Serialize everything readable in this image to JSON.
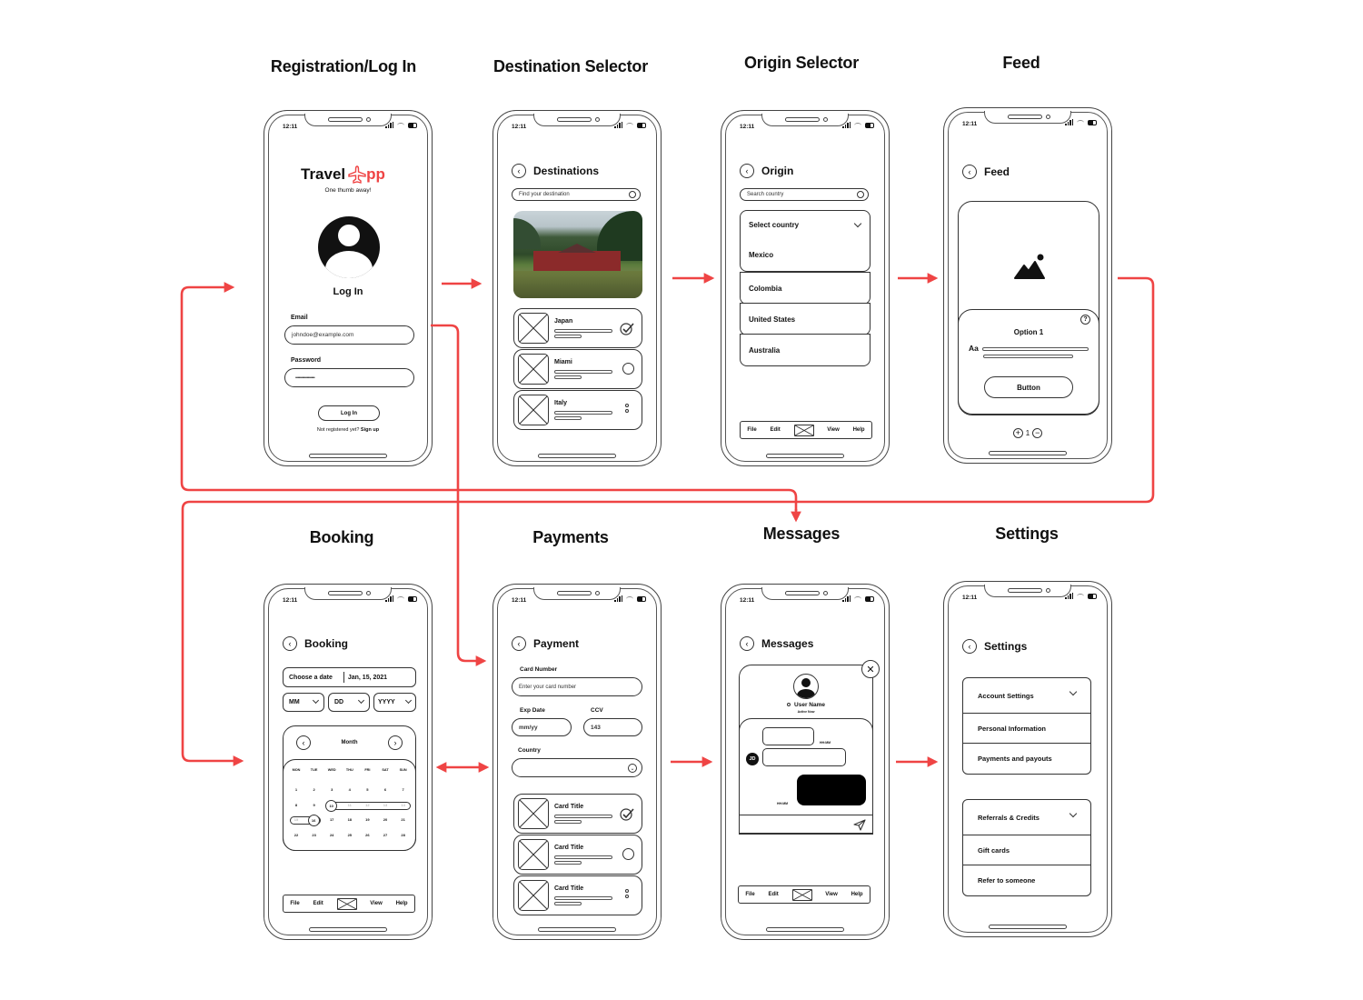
{
  "accent_color": "#ef4444",
  "screen_titles": {
    "login": "Registration/Log In",
    "destinations": "Destination Selector",
    "origin": "Origin Selector",
    "feed": "Feed",
    "booking": "Booking",
    "payments": "Payments",
    "messages": "Messages",
    "settings": "Settings"
  },
  "status_bar": {
    "time": "12:11"
  },
  "login": {
    "brand_prefix": "Travel",
    "brand_suffix": "pp",
    "tagline": "One thumb away!",
    "heading": "Log In",
    "email_label": "Email",
    "email_value": "johndoe@example.com",
    "password_label": "Password",
    "password_value": "•••••••••••••••••",
    "login_button": "Log In",
    "signup_prompt": "Not registered yet?",
    "signup_link": "Sign up"
  },
  "destinations": {
    "header": "Destinations",
    "search_placeholder": "Find your destination",
    "items": [
      {
        "title": "Japan",
        "state": "checked"
      },
      {
        "title": "Miami",
        "state": "radio"
      },
      {
        "title": "Italy",
        "state": "more"
      }
    ]
  },
  "origin": {
    "header": "Origin",
    "search_placeholder": "Search country",
    "select_label": "Select country",
    "countries": [
      "Mexico",
      "Colombia",
      "United States",
      "Australia"
    ],
    "menu": [
      "File",
      "Edit",
      "View",
      "Help"
    ]
  },
  "feed": {
    "header": "Feed",
    "option_title": "Option 1",
    "text_sample": "Aa",
    "button_label": "Button",
    "counter_value": "1"
  },
  "booking": {
    "header": "Booking",
    "date_label": "Choose a date",
    "date_value": "Jan, 15, 2021",
    "selects": [
      "MM",
      "DD",
      "YYYY"
    ],
    "calendar_month": "Month",
    "weekdays": [
      "MON",
      "TUE",
      "WED",
      "THU",
      "FRI",
      "SAT",
      "SUN"
    ],
    "weeks": [
      [
        "1",
        "2",
        "3",
        "4",
        "5",
        "6",
        "7"
      ],
      [
        "8",
        "9",
        "10",
        "11",
        "12",
        "13",
        "14"
      ],
      [
        "15",
        "16",
        "17",
        "18",
        "19",
        "20",
        "21"
      ],
      [
        "22",
        "23",
        "24",
        "25",
        "26",
        "27",
        "28"
      ]
    ],
    "range_start": "10",
    "range_end": "16",
    "menu": [
      "File",
      "Edit",
      "View",
      "Help"
    ]
  },
  "payments": {
    "header": "Payment",
    "card_number_label": "Card Number",
    "card_number_placeholder": "Enter your card number",
    "exp_label": "Exp Date",
    "exp_value": "mm/yy",
    "ccv_label": "CCV",
    "ccv_value": "143",
    "country_label": "Country",
    "cards": [
      {
        "title": "Card Title",
        "state": "checked"
      },
      {
        "title": "Card Title",
        "state": "radio"
      },
      {
        "title": "Card Title",
        "state": "more"
      }
    ]
  },
  "messages": {
    "header": "Messages",
    "user_name": "User Name",
    "user_status": "Active Now",
    "timestamp": "HH:MM",
    "avatar_initials": "JD",
    "menu": [
      "File",
      "Edit",
      "View",
      "Help"
    ]
  },
  "settings": {
    "header": "Settings",
    "groups": [
      {
        "title": "Account Settings",
        "items": [
          "Personal Information",
          "Payments and payouts"
        ]
      },
      {
        "title": "Referrals & Credits",
        "items": [
          "Gift cards",
          "Refer to someone"
        ]
      }
    ]
  }
}
